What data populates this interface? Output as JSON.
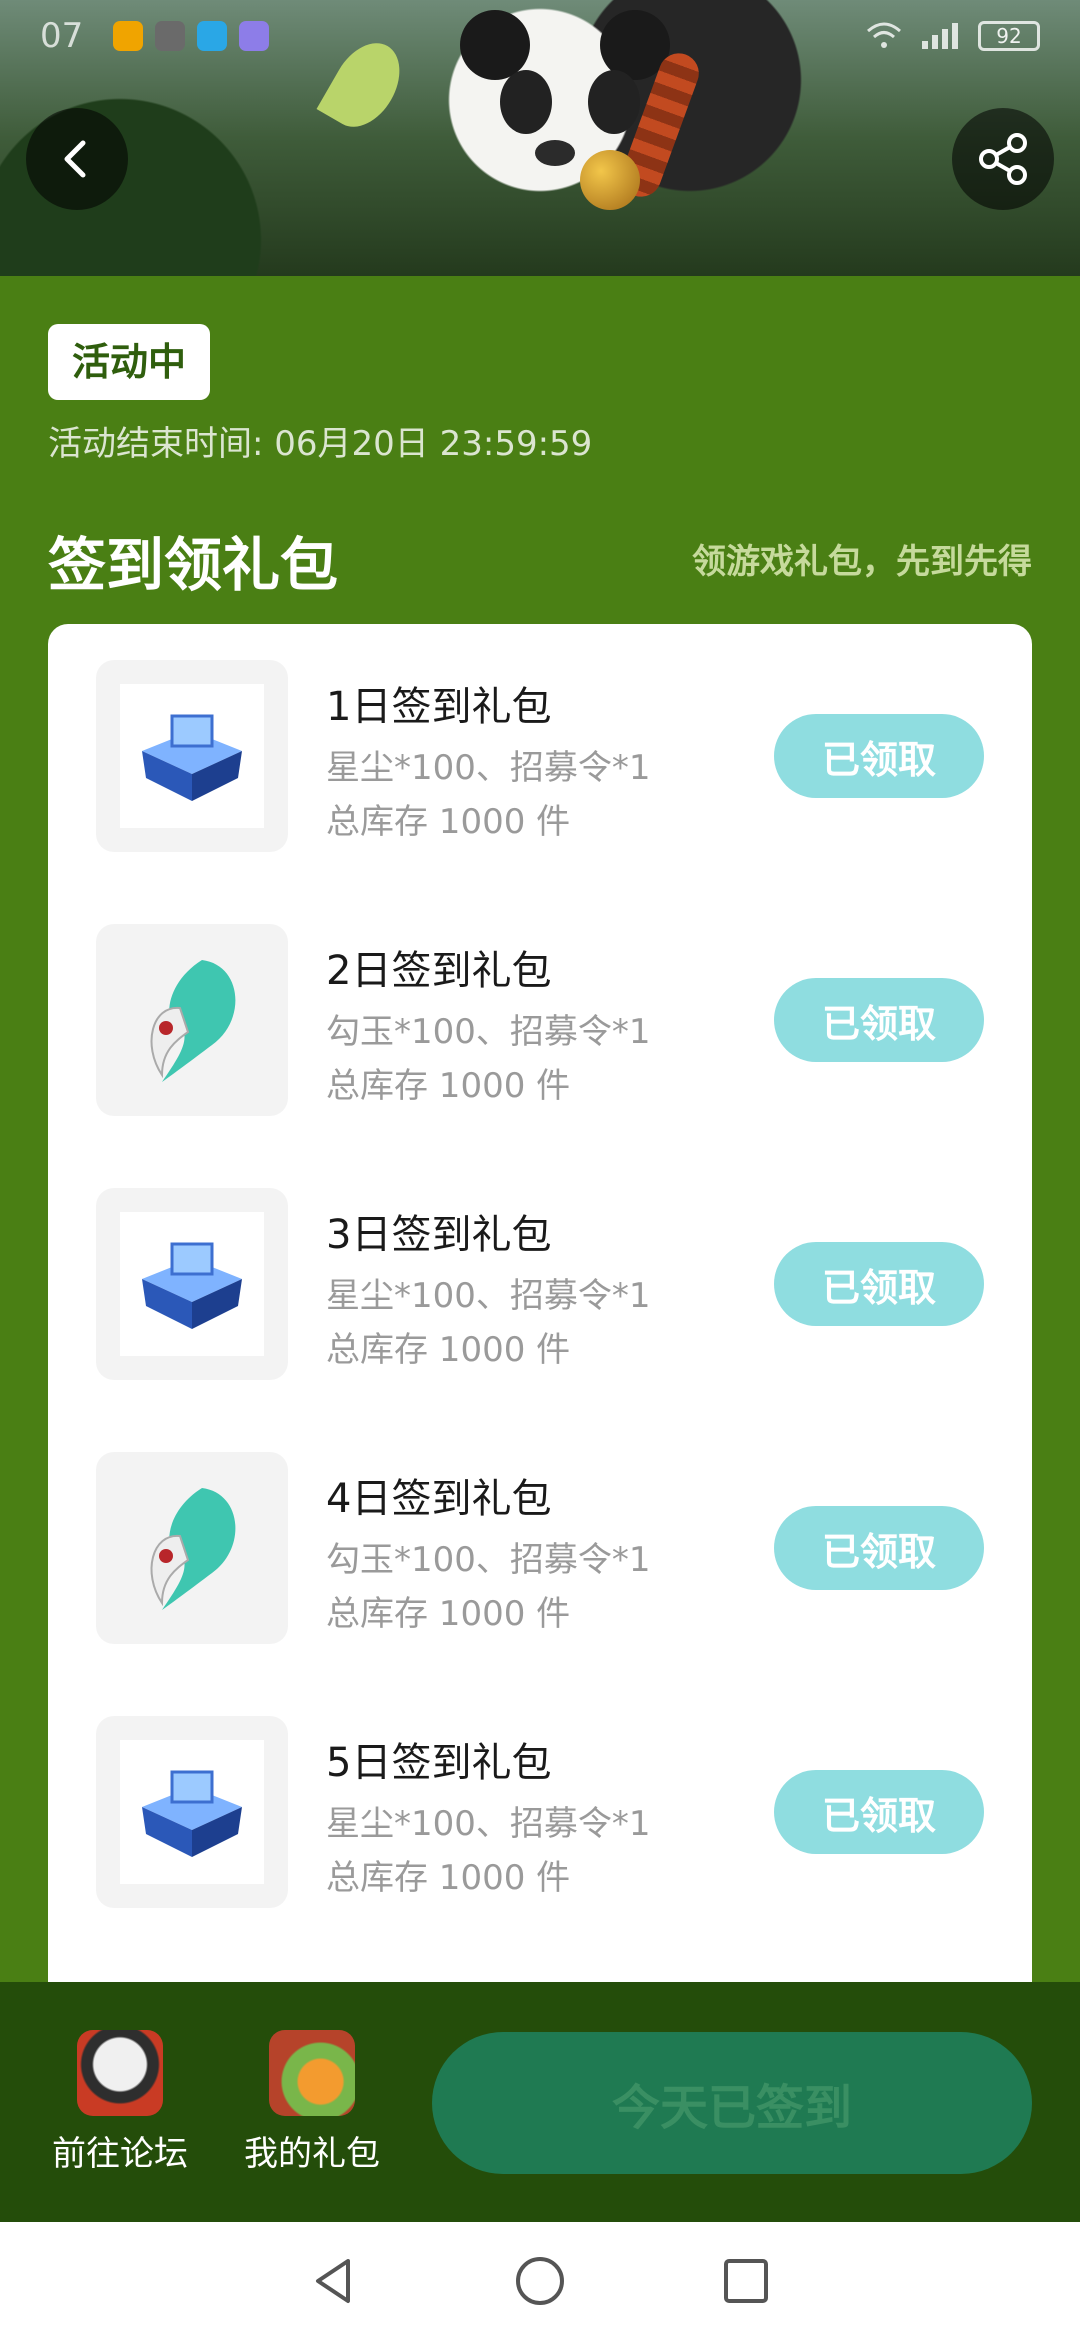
{
  "status_bar": {
    "time": "07",
    "battery": "92"
  },
  "header": {
    "back_icon": "chevron-left-icon",
    "share_icon": "share-icon"
  },
  "activity": {
    "status_badge": "活动中",
    "end_time": "活动结束时间: 06月20日 23:59:59"
  },
  "section": {
    "title": "签到领礼包",
    "subtitle": "领游戏礼包，先到先得"
  },
  "gifts": [
    {
      "name": "1日签到礼包",
      "contents": "星尘*100、招募令*1",
      "stock": "总库存 1000 件",
      "button": "已领取",
      "icon": "blue-chest-icon"
    },
    {
      "name": "2日签到礼包",
      "contents": "勾玉*100、招募令*1",
      "stock": "总库存 1000 件",
      "button": "已领取",
      "icon": "jade-magatama-icon"
    },
    {
      "name": "3日签到礼包",
      "contents": "星尘*100、招募令*1",
      "stock": "总库存 1000 件",
      "button": "已领取",
      "icon": "blue-chest-icon"
    },
    {
      "name": "4日签到礼包",
      "contents": "勾玉*100、招募令*1",
      "stock": "总库存 1000 件",
      "button": "已领取",
      "icon": "jade-magatama-icon"
    },
    {
      "name": "5日签到礼包",
      "contents": "星尘*100、招募令*1",
      "stock": "总库存 1000 件",
      "button": "已领取",
      "icon": "blue-chest-icon"
    }
  ],
  "bottom": {
    "forum_label": "前往论坛",
    "my_gifts_label": "我的礼包",
    "signed_label": "今天已签到"
  },
  "colors": {
    "page_green": "#4a7f14",
    "bottom_bar": "#244d0a",
    "claimed_button": "#8fdde0",
    "signed_button": "#1f7a52"
  }
}
